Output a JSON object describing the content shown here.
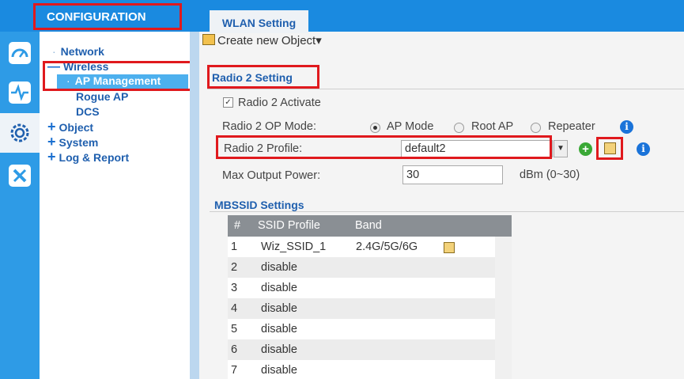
{
  "header": {
    "config_title": "CONFIGURATION"
  },
  "sidebar": {
    "items": [
      {
        "label": "Network"
      },
      {
        "label": "Wireless"
      },
      {
        "label": "AP Management"
      },
      {
        "label": "Rogue AP"
      },
      {
        "label": "DCS"
      },
      {
        "label": "Object"
      },
      {
        "label": "System"
      },
      {
        "label": "Log & Report"
      }
    ]
  },
  "tabs": {
    "active_label": "WLAN Setting"
  },
  "toolbar": {
    "create_label": "Create new Object▾"
  },
  "radio2": {
    "section_title": "Radio 2 Setting",
    "activate_label": "Radio 2 Activate",
    "op_mode_label": "Radio 2 OP Mode:",
    "op_mode_options": [
      "AP Mode",
      "Root AP",
      "Repeater"
    ],
    "op_mode_selected": "AP Mode",
    "profile_label": "Radio 2 Profile:",
    "profile_value": "default2",
    "power_label": "Max Output Power:",
    "power_value": "30",
    "power_unit": "dBm (0~30)"
  },
  "mbssid": {
    "title": "MBSSID Settings",
    "columns": [
      "#",
      "SSID Profile",
      "Band"
    ],
    "rows": [
      {
        "num": "1",
        "profile": "Wiz_SSID_1",
        "band": "2.4G/5G/6G"
      },
      {
        "num": "2",
        "profile": "disable",
        "band": ""
      },
      {
        "num": "3",
        "profile": "disable",
        "band": ""
      },
      {
        "num": "4",
        "profile": "disable",
        "band": ""
      },
      {
        "num": "5",
        "profile": "disable",
        "band": ""
      },
      {
        "num": "6",
        "profile": "disable",
        "band": ""
      },
      {
        "num": "7",
        "profile": "disable",
        "band": ""
      }
    ]
  },
  "colors": {
    "accent": "#1a8ae0",
    "highlight": "#e0191d",
    "link": "#1f5fae"
  }
}
